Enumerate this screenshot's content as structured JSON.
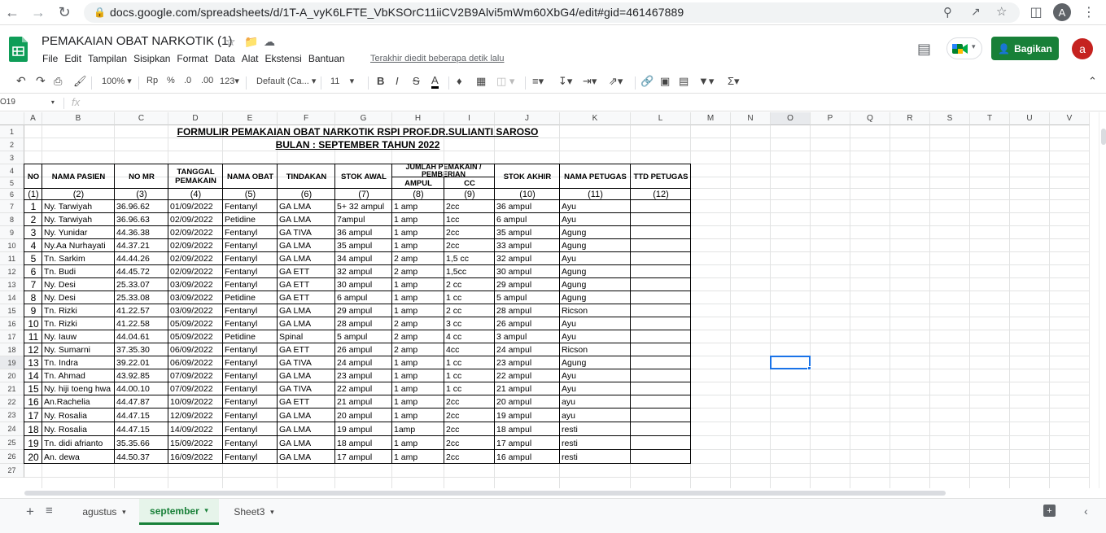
{
  "browser": {
    "url": "docs.google.com/spreadsheets/d/1T-A_vyK6LFTE_VbKSOrC11iiCV2B9Alvi5mWm60XbG4/edit#gid=461467889",
    "profile_initial": "A"
  },
  "doc": {
    "title": "PEMAKAIAN OBAT NARKOTIK (1)",
    "menus": [
      "File",
      "Edit",
      "Tampilan",
      "Sisipkan",
      "Format",
      "Data",
      "Alat",
      "Ekstensi",
      "Bantuan"
    ],
    "last_edit": "Terakhir diedit beberapa detik lalu",
    "share_label": "Bagikan",
    "user_initial": "a"
  },
  "toolbar": {
    "zoom": "100%",
    "currency": "Rp",
    "percent": "%",
    "dec_decrease": ".0",
    "dec_increase": ".00",
    "more_formats": "123",
    "font": "Default (Ca...",
    "font_size": "11"
  },
  "formula": {
    "cell_ref": "O19",
    "fx": "fx"
  },
  "columns": [
    "A",
    "B",
    "C",
    "D",
    "E",
    "F",
    "G",
    "H",
    "I",
    "J",
    "K",
    "L",
    "M",
    "N",
    "O",
    "P",
    "Q",
    "R",
    "S",
    "T",
    "U",
    "V"
  ],
  "rows": [
    "1",
    "2",
    "3",
    "4",
    "5",
    "6",
    "7",
    "8",
    "9",
    "10",
    "11",
    "12",
    "13",
    "14",
    "15",
    "16",
    "17",
    "18",
    "19",
    "20",
    "21",
    "22",
    "23",
    "24",
    "25",
    "26",
    "27"
  ],
  "sheet": {
    "title1": "FORMULIR PEMAKAIAN OBAT NARKOTIK RSPI PROF.DR.SULIANTI SAROSO ",
    "title2": "BULAN : SEPTEMBER TAHUN 2022",
    "headers": {
      "no": "NO",
      "nama_pasien": "NAMA PASIEN",
      "no_mr": "NO MR",
      "tanggal": "TANGGAL PEMAKAIN",
      "nama_obat": "NAMA OBAT",
      "tindakan": "TINDAKAN",
      "stok_awal": "STOK AWAL",
      "jumlah": "JUMLAH PEMAKAIN / PEMBERIAN",
      "ampul": "AMPUL",
      "cc": "CC",
      "stok_akhir": "STOK AKHIR",
      "nama_petugas": "NAMA PETUGAS",
      "ttd_petugas": "TTD PETUGAS"
    },
    "numbers": [
      "(1)",
      "(2)",
      "(3)",
      "(4)",
      "(5)",
      "(6)",
      "(7)",
      "(8)",
      "(9)",
      "(10)",
      "(11)",
      "(12)"
    ],
    "data": [
      [
        "1",
        "Ny. Tarwiyah",
        "36.96.62",
        "01/09/2022",
        "Fentanyl",
        "GA LMA",
        "5+ 32 ampul",
        "1 amp",
        "2cc",
        "36 ampul",
        "Ayu",
        ""
      ],
      [
        "2",
        "Ny. Tarwiyah",
        "36.96.63",
        "02/09/2022",
        "Petidine",
        "GA LMA",
        "7ampul",
        "1 amp",
        "1cc",
        "6 ampul",
        "Ayu",
        ""
      ],
      [
        "3",
        "Ny. Yunidar",
        "44.36.38",
        "02/09/2022",
        "Fentanyl",
        "GA TIVA",
        "36 ampul",
        "1 amp",
        "2cc",
        "35 ampul",
        "Agung",
        ""
      ],
      [
        "4",
        "Ny.Aa Nurhayati",
        "44.37.21",
        "02/09/2022",
        "Fentanyl",
        "GA LMA",
        "35 ampul",
        "1 amp",
        "2cc",
        "33 ampul",
        "Agung",
        ""
      ],
      [
        "5",
        "Tn. Sarkim",
        "44.44.26",
        "02/09/2022",
        "Fentanyl",
        "GA LMA",
        "34 ampul",
        "2 amp",
        "1,5 cc",
        "32 ampul",
        "Ayu",
        ""
      ],
      [
        "6",
        "Tn. Budi",
        "44.45.72",
        "02/09/2022",
        "Fentanyl",
        "GA ETT",
        "32 ampul",
        "2 amp",
        "1,5cc",
        "30 ampul",
        "Agung",
        ""
      ],
      [
        "7",
        "Ny. Desi",
        "25.33.07",
        "03/09/2022",
        "Fentanyl",
        "GA ETT",
        "30 ampul",
        "1 amp",
        "2 cc",
        "29 ampul",
        "Agung",
        ""
      ],
      [
        "8",
        "Ny. Desi",
        "25.33.08",
        "03/09/2022",
        "Petidine",
        "GA ETT",
        "6 ampul",
        "1 amp",
        "1 cc",
        "5 ampul",
        "Agung",
        ""
      ],
      [
        "9",
        "Tn. Rizki",
        "41.22.57",
        "03/09/2022",
        "Fentanyl",
        "GA LMA",
        "29 ampul",
        "1 amp",
        "2 cc",
        "28 ampul",
        "Ricson",
        ""
      ],
      [
        "10",
        "Tn. Rizki",
        "41.22.58",
        "05/09/2022",
        "Fentanyl",
        "GA LMA",
        "28 ampul",
        "2 amp",
        "3 cc",
        "26 ampul",
        "Ayu",
        ""
      ],
      [
        "11",
        "Ny. Iauw",
        "44.04.61",
        "05/09/2022",
        "Petidine",
        "Spinal",
        "5 ampul",
        "2 amp",
        "4 cc",
        "3 ampul",
        "Ayu",
        ""
      ],
      [
        "12",
        "Ny. Sumarni",
        "37.35.30",
        "06/09/2022",
        "Fentanyl",
        "GA ETT",
        "26 ampul",
        "2 amp",
        "4cc",
        "24 ampul",
        "Ricson",
        ""
      ],
      [
        "13",
        "Tn. Indra",
        "39.22.01",
        "06/09/2022",
        "Fentanyl",
        "GA TIVA",
        "24 ampul",
        "1 amp",
        "1 cc",
        "23 ampul",
        "Agung",
        ""
      ],
      [
        "14",
        "Tn. Ahmad",
        "43.92.85",
        "07/09/2022",
        "Fentanyl",
        "GA LMA",
        "23 ampul",
        "1 amp",
        "1 cc",
        "22 ampul",
        "Ayu",
        ""
      ],
      [
        "15",
        "Ny. hiji toeng hwa",
        "44.00.10",
        "07/09/2022",
        "Fentanyl",
        "GA TIVA",
        "22 ampul",
        "1 amp",
        "1 cc",
        "21 ampul",
        "Ayu",
        ""
      ],
      [
        "16",
        "An.Rachelia",
        "44.47.87",
        "10/09/2022",
        "Fentanyl",
        "GA ETT",
        "21 ampul",
        "1 amp",
        "2cc",
        "20 ampul",
        "ayu",
        ""
      ],
      [
        "17",
        "Ny. Rosalia",
        "44.47.15",
        "12/09/2022",
        "Fentanyl",
        "GA LMA",
        "20 ampul",
        "1 amp",
        "2cc",
        "19 ampul",
        "ayu",
        ""
      ],
      [
        "18",
        "Ny. Rosalia",
        "44.47.15",
        "14/09/2022",
        "Fentanyl",
        "GA LMA",
        "19 ampul",
        "1amp",
        "2cc",
        "18 ampul",
        "resti",
        ""
      ],
      [
        "19",
        "Tn. didi afrianto",
        "35.35.66",
        "15/09/2022",
        "Fentanyl",
        "GA LMA",
        "18 ampul",
        "1 amp",
        "2cc",
        "17 ampul",
        "resti",
        ""
      ],
      [
        "20",
        "An. dewa",
        "44.50.37",
        "16/09/2022",
        "Fentanyl",
        "GA LMA",
        "17 ampul",
        "1 amp",
        "2cc",
        "16 ampul",
        "resti",
        ""
      ]
    ]
  },
  "tabs": [
    {
      "label": "agustus",
      "active": false
    },
    {
      "label": "september",
      "active": true
    },
    {
      "label": "Sheet3",
      "active": false
    }
  ]
}
